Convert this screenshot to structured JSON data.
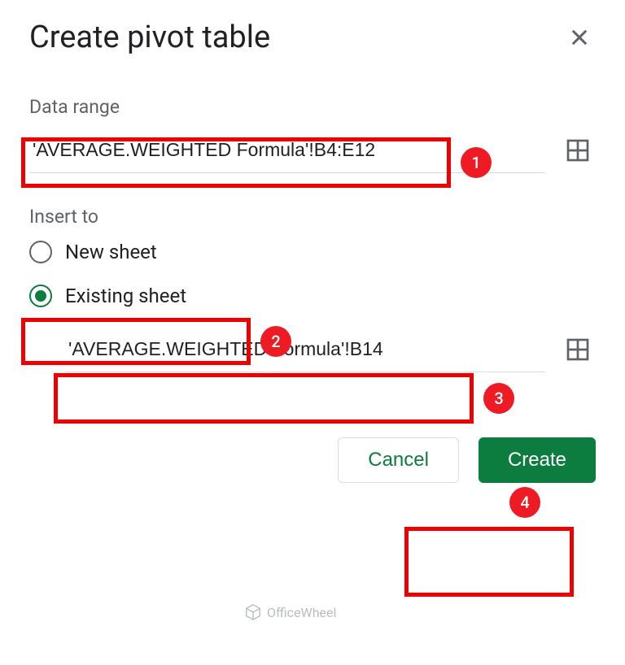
{
  "dialog": {
    "title": "Create pivot table"
  },
  "data_range": {
    "label": "Data range",
    "value": "'AVERAGE.WEIGHTED Formula'!B4:E12"
  },
  "insert_to": {
    "label": "Insert to",
    "options": {
      "new_sheet": "New sheet",
      "existing_sheet": "Existing sheet"
    },
    "selected": "existing_sheet",
    "existing_target": "'AVERAGE.WEIGHTED Formula'!B14"
  },
  "buttons": {
    "cancel": "Cancel",
    "create": "Create"
  },
  "annotations": {
    "badge1": "1",
    "badge2": "2",
    "badge3": "3",
    "badge4": "4"
  },
  "watermark": "OfficeWheel"
}
